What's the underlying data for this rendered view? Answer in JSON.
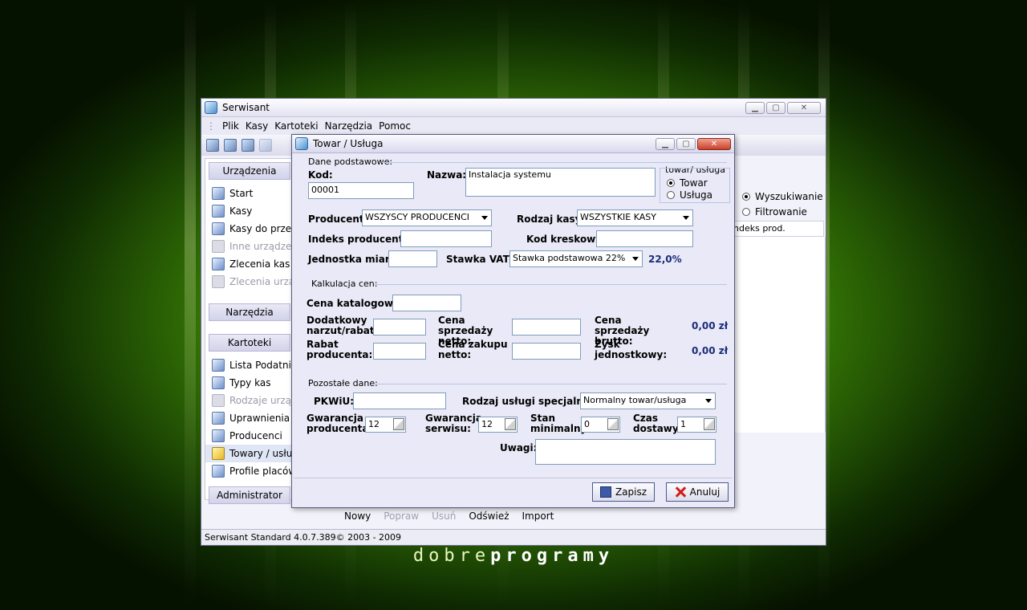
{
  "desktop": {
    "brand_light": "dobre",
    "brand_bold": "programy"
  },
  "main_window": {
    "title": "Serwisant",
    "menu": [
      "Plik",
      "Kasy",
      "Kartoteki",
      "Narzędzia",
      "Pomoc"
    ],
    "sidebar": {
      "section_devices": "Urządzenia",
      "devices": [
        {
          "label": "Start",
          "icon": "home-icon"
        },
        {
          "label": "Kasy",
          "icon": "register-icon"
        },
        {
          "label": "Kasy do przeglą",
          "icon": "search-register-icon"
        },
        {
          "label": "Inne urządzenia",
          "icon": "device-icon",
          "disabled": true
        },
        {
          "label": "Zlecenia kas",
          "icon": "order-icon"
        },
        {
          "label": "Zlecenia urządz",
          "icon": "device-order-icon",
          "disabled": true
        }
      ],
      "section_tools": "Narzędzia",
      "section_files": "Kartoteki",
      "files": [
        {
          "label": "Lista Podatników",
          "icon": "users-icon"
        },
        {
          "label": "Typy kas",
          "icon": "register-types-icon"
        },
        {
          "label": "Rodzaje urządz",
          "icon": "device-types-icon",
          "disabled": true
        },
        {
          "label": "Uprawnienia",
          "icon": "permissions-icon"
        },
        {
          "label": "Producenci",
          "icon": "producers-icon"
        },
        {
          "label": "Towary / usługi",
          "icon": "goods-icon"
        },
        {
          "label": "Profile placówek",
          "icon": "profiles-icon"
        }
      ],
      "section_admin": "Administrator"
    },
    "right_panel": {
      "search_label": "Wyszukiwanie",
      "filter_label": "Filtrowanie",
      "column_header": "ndeks prod."
    },
    "bottom_actions": {
      "new": "Nowy",
      "edit": "Popraw",
      "delete": "Usuń",
      "refresh": "Odśwież",
      "import": "Import"
    },
    "status": "Serwisant Standard 4.0.7.389© 2003 - 2009"
  },
  "dialog": {
    "title": "Towar / Usługa",
    "basic": {
      "group": "Dane podstawowe:",
      "code_label": "Kod:",
      "code_value": "00001",
      "name_label": "Nazwa:",
      "name_value": "Instalacja systemu",
      "type_group": "towar/ usługa",
      "type_goods": "Towar",
      "type_service": "Usługa",
      "producer_label": "Producent:",
      "producer_value": "WSZYSCY PRODUCENCI",
      "register_type_label": "Rodzaj kasy:",
      "register_type_value": "WSZYSTKIE KASY",
      "producer_index_label": "Indeks producenta:",
      "barcode_label": "Kod kreskowy:",
      "unit_label": "Jednostka miary:",
      "vat_label": "Stawka VAT:",
      "vat_value": "Stawka podstawowa 22%",
      "vat_percent": "22,0%"
    },
    "pricing": {
      "group": "Kalkulacja cen:",
      "catalog_label": "Cena katalogowa:",
      "markup_label": "Dodatkowy narzut/rabat:",
      "sale_net_label": "Cena sprzedaży netto:",
      "sale_gross_label": "Cena sprzedaży brutto:",
      "sale_gross_value": "0,00 zł",
      "producer_discount_label": "Rabat producenta:",
      "purchase_net_label": "Cena zakupu netto:",
      "unit_profit_label": "Zysk jednostkowy:",
      "unit_profit_value": "0,00 zł"
    },
    "other": {
      "group": "Pozostałe dane:",
      "pkwiu_label": "PKWiU:",
      "special_label": "Rodzaj usługi specjalnej:",
      "special_value": "Normalny towar/usługa",
      "warranty_producer_label": "Gwarancja producenta:",
      "warranty_producer_value": "12",
      "warranty_service_label": "Gwarancja serwisu:",
      "warranty_service_value": "12",
      "min_stock_label": "Stan minimalny:",
      "min_stock_value": "0",
      "delivery_time_label": "Czas dostawy:",
      "delivery_time_value": "1",
      "notes_label": "Uwagi:"
    },
    "buttons": {
      "save": "Zapisz",
      "cancel": "Anuluj"
    }
  }
}
